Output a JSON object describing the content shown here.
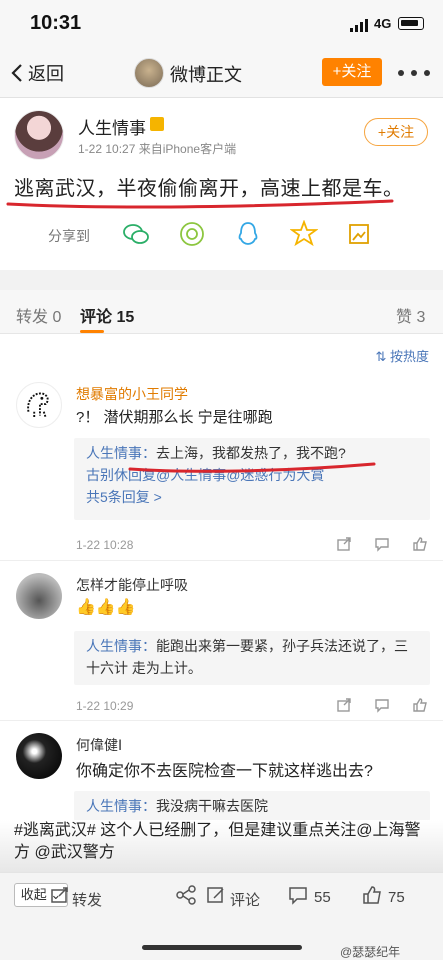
{
  "status": {
    "time": "10:31",
    "network": "4G"
  },
  "nav": {
    "back_label": "返回",
    "title": "微博正文",
    "follow_label": "+关注"
  },
  "post": {
    "author": "人生情事",
    "meta": "1-22 10:27  来自iPhone客户端",
    "follow_label": "+关注",
    "text": "逃离武汉，半夜偷偷离开，高速上都是车。",
    "share_label": "分享到",
    "share_targets": [
      "wechat-icon",
      "moments-icon",
      "qq-icon",
      "qzone-icon",
      "save-image-icon"
    ]
  },
  "tabs": {
    "repost": "转发 0",
    "comment": "评论 15",
    "like": "赞 3",
    "sort_label": "按热度"
  },
  "comments": [
    {
      "name": "想暴富的小王同学",
      "text": "?！ 潜伏期那么长 宁是往哪跑",
      "replies": [
        {
          "who": "人生情事：",
          "text": "去上海，我都发热了，我不跑?"
        },
        {
          "who": "古别休回复@人生情事@迷惑行为大賞",
          "text": ""
        }
      ],
      "more_replies": "共5条回复 >",
      "time": "1-22 10:28"
    },
    {
      "name": "怎样才能停止呼吸",
      "text": "👍👍👍",
      "replies": [
        {
          "who": "人生情事：",
          "text": "能跑出来第一要紧，孙子兵法还说了，三十六计 走为上计。"
        }
      ],
      "time": "1-22 10:29"
    },
    {
      "name": "何偉健Ⅰ",
      "text": "你确定你不去医院检查一下就这样逃出去?",
      "replies": [
        {
          "who": "人生情事：",
          "text": "我没病干嘛去医院"
        }
      ]
    }
  ],
  "overlay_text": "#逃离武汉# 这个人已经删了，但是建议重点关注@上海警方 @武汉警方",
  "bottom": {
    "collapse_label": "收起",
    "repost_label": "转发",
    "comment_label": "评论",
    "comment_count": "55",
    "like_count": "75",
    "watermark": "@瑟瑟纪年"
  },
  "colors": {
    "accent": "#ff8200",
    "link": "#4a76b8",
    "underline_red": "#d8262d"
  }
}
